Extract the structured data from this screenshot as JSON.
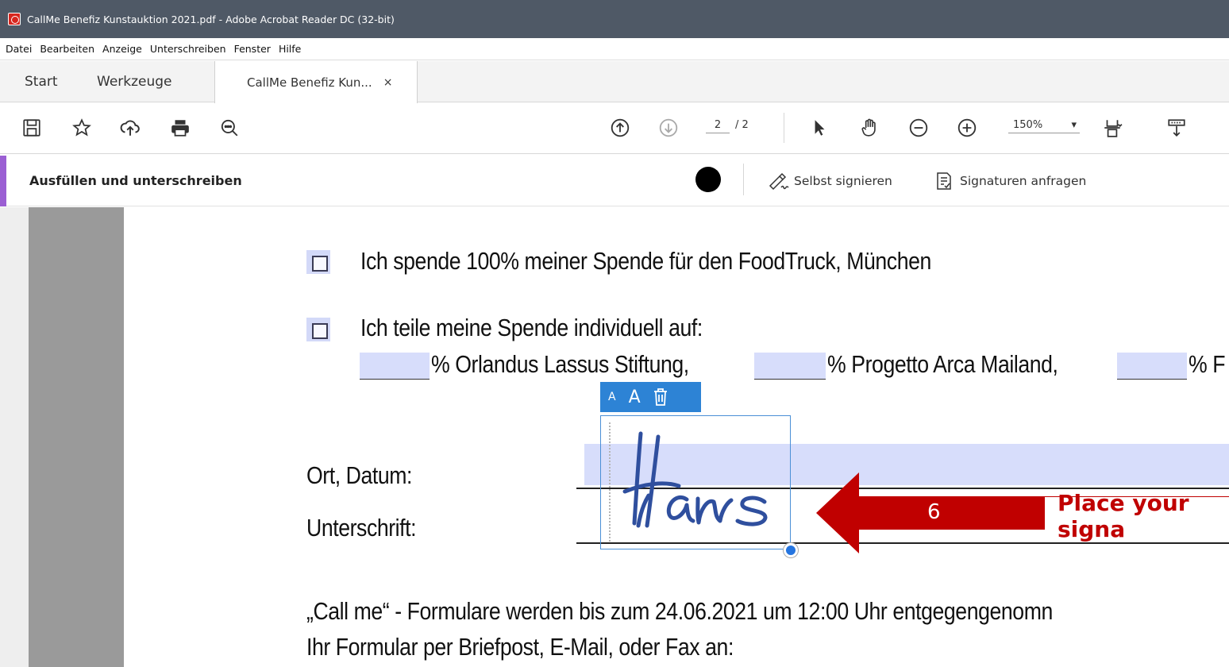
{
  "window": {
    "title": "CallMe Benefiz Kunstauktion 2021.pdf - Adobe Acrobat Reader DC (32-bit)"
  },
  "menubar": {
    "items": [
      "Datei",
      "Bearbeiten",
      "Anzeige",
      "Unterschreiben",
      "Fenster",
      "Hilfe"
    ]
  },
  "tabs": {
    "start": "Start",
    "tools": "Werkzeuge",
    "document": "CallMe Benefiz Kun...",
    "close_symbol": "×"
  },
  "toolbar": {
    "icons": [
      "save-icon",
      "bookmark-star-icon",
      "upload-cloud-icon",
      "print-icon",
      "search-zoom-icon",
      "page-up-icon",
      "page-down-icon",
      "select-cursor-icon",
      "hand-tool-icon",
      "zoom-out-icon",
      "zoom-in-icon",
      "page-fit-icon",
      "scroll-mode-icon"
    ],
    "page_current": "2",
    "page_total": "/ 2",
    "zoom": "150%",
    "zoom_caret": "▾"
  },
  "sign_bar": {
    "title": "Ausfüllen und unterschreiben",
    "color_swatch": "#000000",
    "self_sign": "Selbst signieren",
    "request_signatures": "Signaturen anfragen"
  },
  "document": {
    "option1": "Ich spende 100% meiner Spende für den FoodTruck, München",
    "option2": "Ich teile meine Spende individuell auf:",
    "split_1": "% Orlandus Lassus Stiftung,",
    "split_2": "% Progetto Arca Mailand,",
    "split_3": "% F",
    "place_date_label": "Ort, Datum:",
    "signature_label": "Unterschrift:",
    "signature_value": "Hans",
    "sig_toolbar_small": "A",
    "sig_toolbar_large": "A",
    "footer_line1": "„Call me“ - Formulare werden bis zum 24.06.2021 um 12:00 Uhr entgegengenomn",
    "footer_line2": "Ihr Formular per Briefpost, E-Mail, oder Fax an:"
  },
  "callout": {
    "step": "6",
    "text": "Place your signa",
    "color": "#c00000"
  },
  "colors": {
    "titlebar": "#4f5966",
    "accent_purple": "#9b5fd3",
    "field_fill": "#d7ddfb",
    "selection_blue": "#2d83d5"
  }
}
